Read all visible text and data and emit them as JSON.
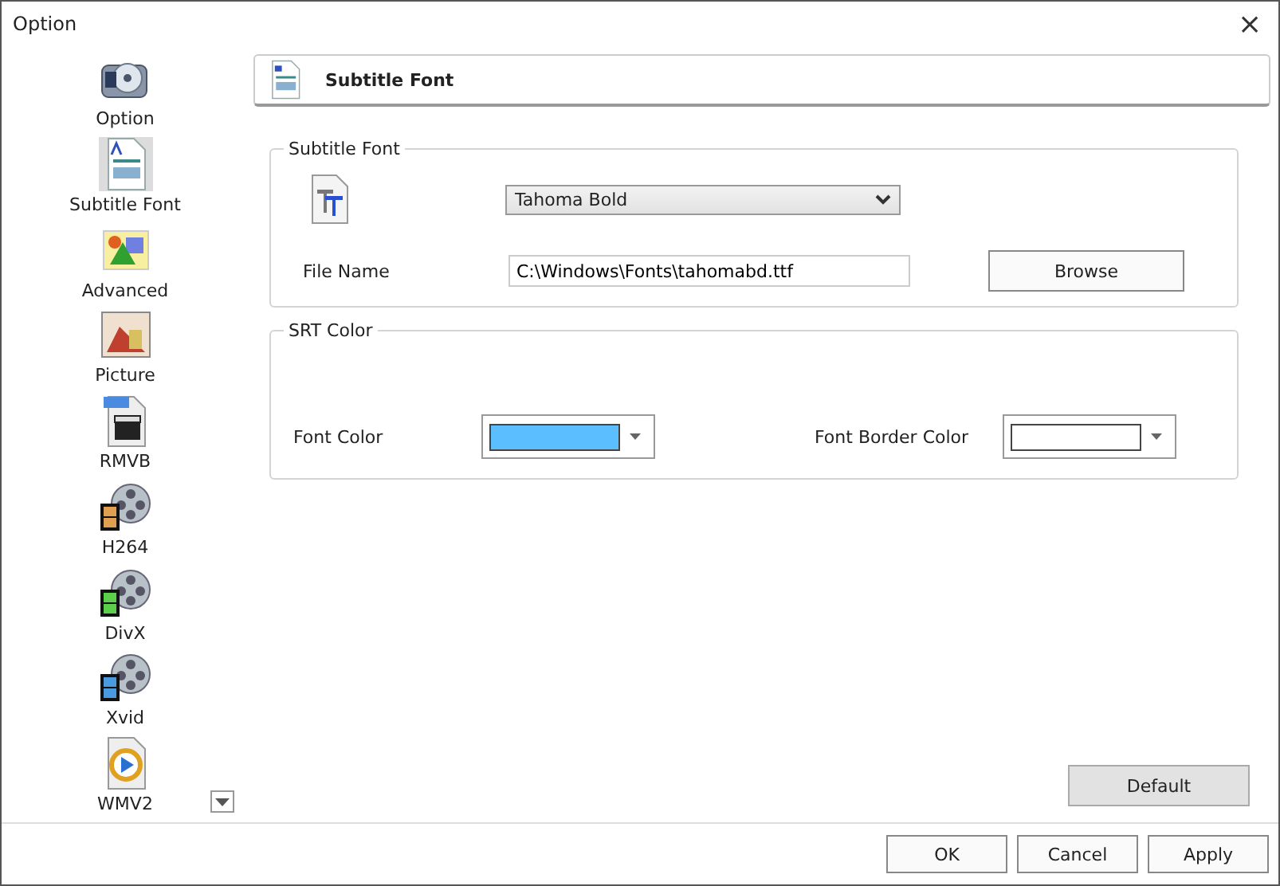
{
  "window": {
    "title": "Option",
    "close": "×"
  },
  "sidebar": {
    "items": [
      {
        "label": "Option",
        "kind": "disc",
        "selected": false
      },
      {
        "label": "Subtitle Font",
        "kind": "document",
        "selected": true
      },
      {
        "label": "Advanced",
        "kind": "landscape",
        "selected": false
      },
      {
        "label": "Picture",
        "kind": "picture",
        "selected": false
      },
      {
        "label": "RMVB",
        "kind": "clapper",
        "selected": false
      },
      {
        "label": "H264",
        "kind": "reel",
        "color": "#e0a050",
        "selected": false
      },
      {
        "label": "DivX",
        "kind": "reel",
        "color": "#5cd04a",
        "selected": false
      },
      {
        "label": "Xvid",
        "kind": "reel",
        "color": "#4a9ae0",
        "selected": false
      },
      {
        "label": "WMV2",
        "kind": "media",
        "selected": false
      }
    ]
  },
  "header": {
    "title": "Subtitle Font"
  },
  "subtitle_font": {
    "legend": "Subtitle Font",
    "font_select": {
      "value": "Tahoma Bold"
    },
    "file_label": "File Name",
    "file_value": "C:\\Windows\\Fonts\\tahomabd.ttf",
    "browse": "Browse"
  },
  "srt_color": {
    "legend": "SRT Color",
    "pickers": [
      {
        "label": "Font Color",
        "color": "#5bbfff"
      },
      {
        "label": "Font Border Color",
        "color": "#ffffff"
      }
    ]
  },
  "default_button": "Default",
  "buttons": [
    "OK",
    "Cancel",
    "Apply"
  ]
}
